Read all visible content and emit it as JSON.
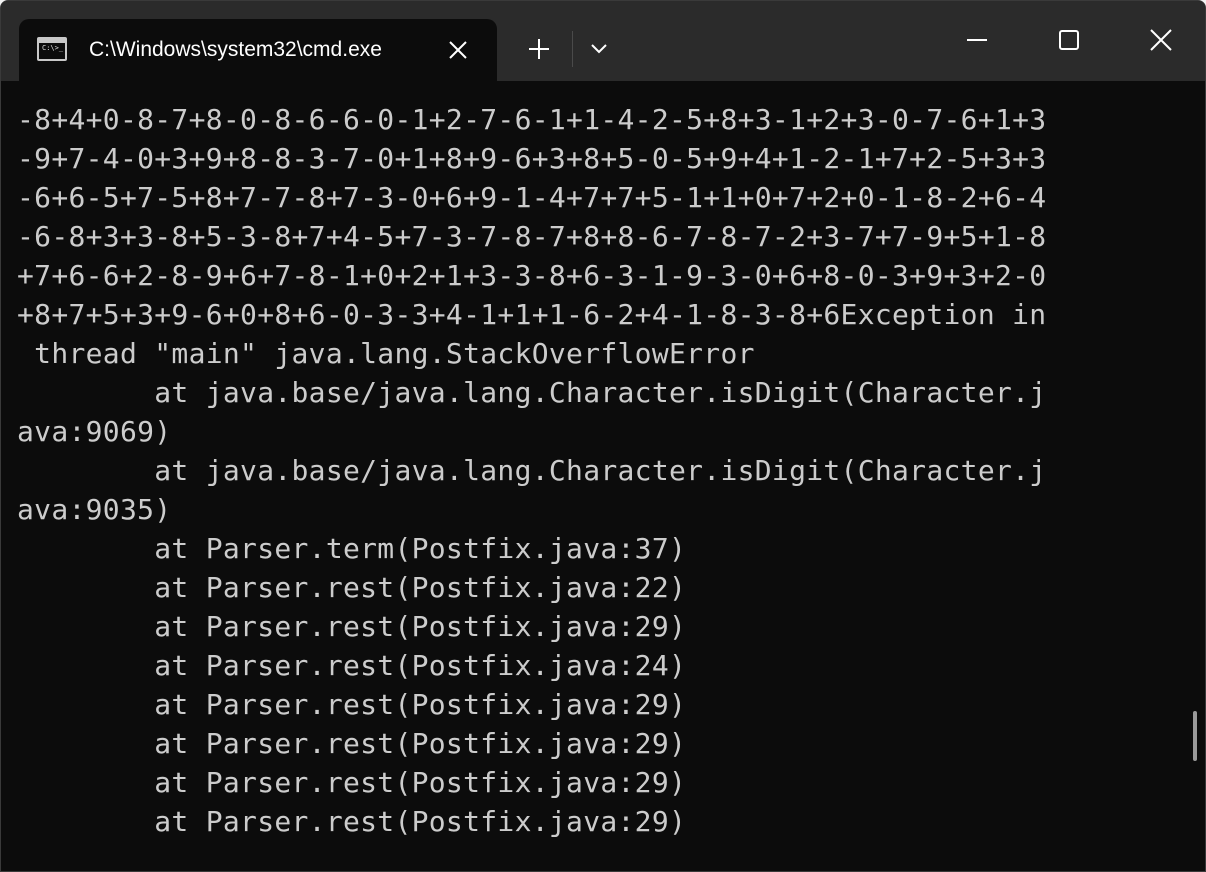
{
  "window": {
    "tab_title": "C:\\Windows\\system32\\cmd.exe",
    "icon_prompt": "C:\\>_"
  },
  "icons": {
    "tab": "cmd-icon",
    "close_tab": "close-icon",
    "new_tab": "plus-icon",
    "dropdown": "chevron-down-icon",
    "minimize": "minimize-icon",
    "maximize": "maximize-icon",
    "close_window": "close-icon"
  },
  "colors": {
    "titlebar": "#2b2b2b",
    "terminal_bg": "#0c0c0c",
    "terminal_fg": "#cccccc"
  },
  "terminal": {
    "lines": [
      "-8+4+0-8-7+8-0-8-6-6-0-1+2-7-6-1+1-4-2-5+8+3-1+2+3-0-7-6+1+3",
      "-9+7-4-0+3+9+8-8-3-7-0+1+8+9-6+3+8+5-0-5+9+4+1-2-1+7+2-5+3+3",
      "-6+6-5+7-5+8+7-7-8+7-3-0+6+9-1-4+7+7+5-1+1+0+7+2+0-1-8-2+6-4",
      "-6-8+3+3-8+5-3-8+7+4-5+7-3-7-8-7+8+8-6-7-8-7-2+3-7+7-9+5+1-8",
      "+7+6-6+2-8-9+6+7-8-1+0+2+1+3-3-8+6-3-1-9-3-0+6+8-0-3+9+3+2-0",
      "+8+7+5+3+9-6+0+8+6-0-3-3+4-1+1+1-6-2+4-1-8-3-8+6Exception in",
      " thread \"main\" java.lang.StackOverflowError",
      "        at java.base/java.lang.Character.isDigit(Character.j",
      "ava:9069)",
      "        at java.base/java.lang.Character.isDigit(Character.j",
      "ava:9035)",
      "        at Parser.term(Postfix.java:37)",
      "        at Parser.rest(Postfix.java:22)",
      "        at Parser.rest(Postfix.java:29)",
      "        at Parser.rest(Postfix.java:24)",
      "        at Parser.rest(Postfix.java:29)",
      "        at Parser.rest(Postfix.java:29)",
      "        at Parser.rest(Postfix.java:29)",
      "        at Parser.rest(Postfix.java:29)"
    ]
  }
}
